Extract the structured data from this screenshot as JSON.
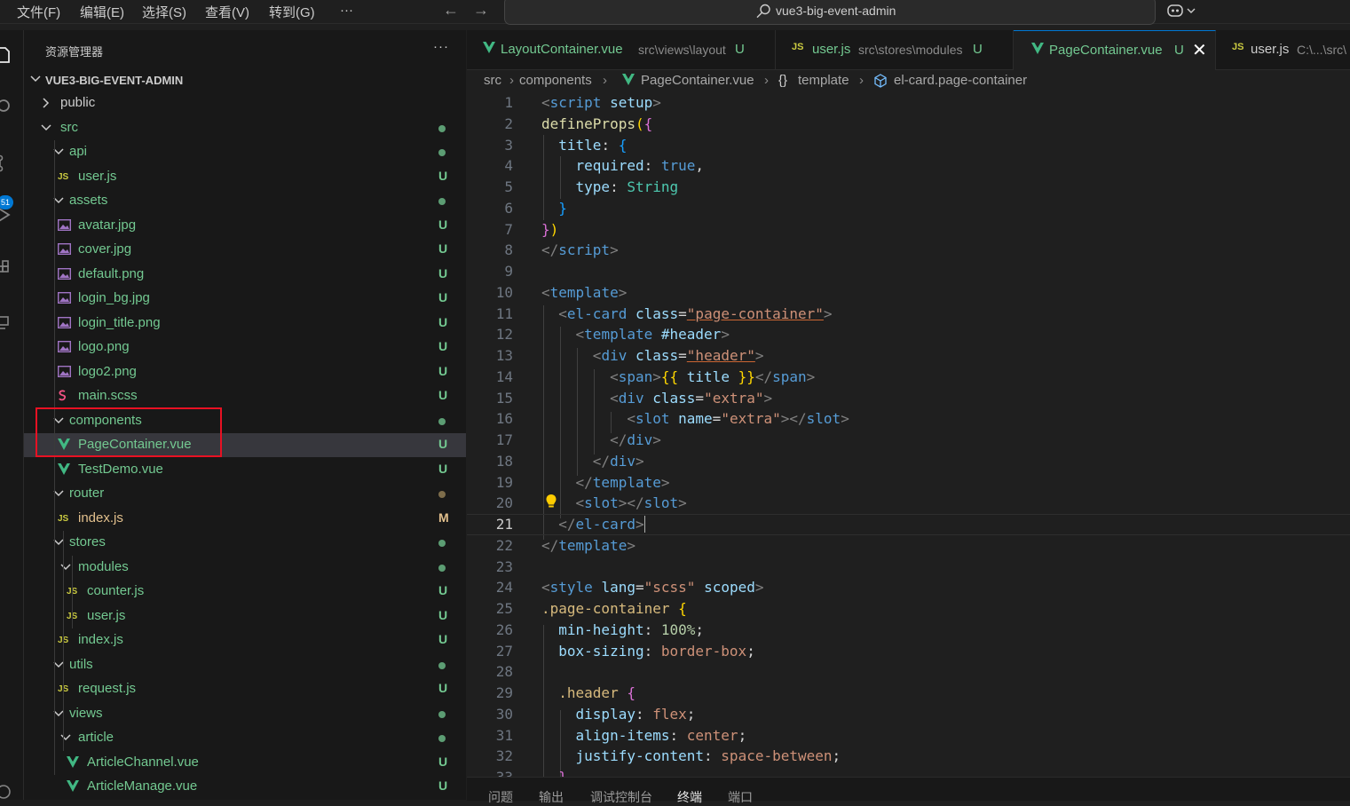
{
  "menu": [
    "文件(F)",
    "编辑(E)",
    "选择(S)",
    "查看(V)",
    "转到(G)",
    "···"
  ],
  "search": {
    "text": "vue3-big-event-admin"
  },
  "activity": {
    "scm_badge": "51"
  },
  "explorer": {
    "title": "资源管理器",
    "more": "···",
    "root": "VUE3-BIG-EVENT-ADMIN",
    "items": [
      {
        "label": "public",
        "kind": "folder-closed",
        "depth": 0,
        "status": "",
        "dot": false
      },
      {
        "label": "src",
        "kind": "folder",
        "depth": 0,
        "status": "",
        "dot": true,
        "dot_color": "#73c991"
      },
      {
        "label": "api",
        "kind": "folder",
        "depth": 1,
        "status": "",
        "dot": true,
        "dot_color": "#73c991"
      },
      {
        "label": "user.js",
        "kind": "js",
        "depth": 1,
        "status": "U"
      },
      {
        "label": "assets",
        "kind": "folder",
        "depth": 1,
        "status": "",
        "dot": true,
        "dot_color": "#73c991"
      },
      {
        "label": "avatar.jpg",
        "kind": "image",
        "depth": 1,
        "status": "U"
      },
      {
        "label": "cover.jpg",
        "kind": "image",
        "depth": 1,
        "status": "U"
      },
      {
        "label": "default.png",
        "kind": "image",
        "depth": 1,
        "status": "U"
      },
      {
        "label": "login_bg.jpg",
        "kind": "image",
        "depth": 1,
        "status": "U"
      },
      {
        "label": "login_title.png",
        "kind": "image",
        "depth": 1,
        "status": "U"
      },
      {
        "label": "logo.png",
        "kind": "image",
        "depth": 1,
        "status": "U"
      },
      {
        "label": "logo2.png",
        "kind": "image",
        "depth": 1,
        "status": "U"
      },
      {
        "label": "main.scss",
        "kind": "scss",
        "depth": 1,
        "status": "U"
      },
      {
        "label": "components",
        "kind": "folder",
        "depth": 1,
        "status": "",
        "dot": true,
        "dot_color": "#73c991"
      },
      {
        "label": "PageContainer.vue",
        "kind": "vue",
        "depth": 1,
        "status": "U",
        "selected": true
      },
      {
        "label": "TestDemo.vue",
        "kind": "vue",
        "depth": 1,
        "status": "U"
      },
      {
        "label": "router",
        "kind": "folder",
        "depth": 1,
        "status": "",
        "dot": true,
        "dot_color": "#a08a5c"
      },
      {
        "label": "index.js",
        "kind": "js",
        "depth": 1,
        "status": "M",
        "status_color": "#e2c08d"
      },
      {
        "label": "stores",
        "kind": "folder",
        "depth": 1,
        "status": "",
        "dot": true,
        "dot_color": "#73c991"
      },
      {
        "label": "modules",
        "kind": "folder",
        "depth": 2,
        "status": "",
        "dot": true,
        "dot_color": "#73c991"
      },
      {
        "label": "counter.js",
        "kind": "js",
        "depth": 2,
        "status": "U"
      },
      {
        "label": "user.js",
        "kind": "js",
        "depth": 2,
        "status": "U"
      },
      {
        "label": "index.js",
        "kind": "js",
        "depth": 1,
        "status": "U"
      },
      {
        "label": "utils",
        "kind": "folder",
        "depth": 1,
        "status": "",
        "dot": true,
        "dot_color": "#73c991"
      },
      {
        "label": "request.js",
        "kind": "js",
        "depth": 1,
        "status": "U"
      },
      {
        "label": "views",
        "kind": "folder",
        "depth": 1,
        "status": "",
        "dot": true,
        "dot_color": "#73c991"
      },
      {
        "label": "article",
        "kind": "folder",
        "depth": 2,
        "status": "",
        "dot": true,
        "dot_color": "#73c991"
      },
      {
        "label": "ArticleChannel.vue",
        "kind": "vue",
        "depth": 2,
        "status": "U"
      },
      {
        "label": "ArticleManage.vue",
        "kind": "vue",
        "depth": 2,
        "status": "U"
      }
    ]
  },
  "tabs": [
    {
      "name": "LayoutContainer.vue",
      "path": "src\\views\\layout",
      "status": "U",
      "kind": "vue",
      "active": false
    },
    {
      "name": "user.js",
      "path": "src\\stores\\modules",
      "status": "U",
      "kind": "js",
      "active": false
    },
    {
      "name": "PageContainer.vue",
      "path": "",
      "status": "U",
      "kind": "vue",
      "active": true,
      "close": "✕"
    },
    {
      "name": "user.js",
      "path": "C:\\...\\src\\",
      "status": "",
      "kind": "js",
      "active": false
    }
  ],
  "breadcrumb": {
    "parts": [
      "src",
      "components",
      "PageContainer.vue",
      "template",
      "el-card.page-container"
    ]
  },
  "editor": {
    "current_line": 21,
    "lines": [
      [
        [
          "tk-bracket",
          "<"
        ],
        [
          "tk-tag",
          "script"
        ],
        [
          "tk-plain",
          " "
        ],
        [
          "tk-attr",
          "setup"
        ],
        [
          "tk-bracket",
          ">"
        ]
      ],
      [
        [
          "tk-fn",
          "defineProps"
        ],
        [
          "tk-brace1",
          "("
        ],
        [
          "tk-brace2",
          "{"
        ]
      ],
      [
        [
          "tk-plain",
          "  "
        ],
        [
          "tk-attr",
          "title"
        ],
        [
          "tk-plain",
          ": "
        ],
        [
          "tk-brace3",
          "{"
        ]
      ],
      [
        [
          "tk-plain",
          "    "
        ],
        [
          "tk-attr",
          "required"
        ],
        [
          "tk-plain",
          ": "
        ],
        [
          "tk-kw",
          "true"
        ],
        [
          "tk-plain",
          ","
        ]
      ],
      [
        [
          "tk-plain",
          "    "
        ],
        [
          "tk-attr",
          "type"
        ],
        [
          "tk-plain",
          ": "
        ],
        [
          "tk-type",
          "String"
        ]
      ],
      [
        [
          "tk-plain",
          "  "
        ],
        [
          "tk-brace3",
          "}"
        ]
      ],
      [
        [
          "tk-brace2",
          "}"
        ],
        [
          "tk-brace1",
          ")"
        ]
      ],
      [
        [
          "tk-bracket",
          "</"
        ],
        [
          "tk-tag",
          "script"
        ],
        [
          "tk-bracket",
          ">"
        ]
      ],
      [],
      [
        [
          "tk-bracket",
          "<"
        ],
        [
          "tk-tag",
          "template"
        ],
        [
          "tk-bracket",
          ">"
        ]
      ],
      [
        [
          "tk-plain",
          "  "
        ],
        [
          "tk-bracket",
          "<"
        ],
        [
          "tk-tag",
          "el-card"
        ],
        [
          "tk-plain",
          " "
        ],
        [
          "tk-attr",
          "class"
        ],
        [
          "tk-plain",
          "="
        ],
        [
          "tk-str tk-squig",
          "\"page-container\""
        ],
        [
          "tk-bracket",
          ">"
        ]
      ],
      [
        [
          "tk-plain",
          "    "
        ],
        [
          "tk-bracket",
          "<"
        ],
        [
          "tk-tag",
          "template"
        ],
        [
          "tk-plain",
          " "
        ],
        [
          "tk-attr",
          "#header"
        ],
        [
          "tk-bracket",
          ">"
        ]
      ],
      [
        [
          "tk-plain",
          "      "
        ],
        [
          "tk-bracket",
          "<"
        ],
        [
          "tk-tag",
          "div"
        ],
        [
          "tk-plain",
          " "
        ],
        [
          "tk-attr",
          "class"
        ],
        [
          "tk-plain",
          "="
        ],
        [
          "tk-str tk-squig",
          "\"header\""
        ],
        [
          "tk-bracket",
          ">"
        ]
      ],
      [
        [
          "tk-plain",
          "        "
        ],
        [
          "tk-bracket",
          "<"
        ],
        [
          "tk-tag",
          "span"
        ],
        [
          "tk-bracket",
          ">"
        ],
        [
          "tk-brace1",
          "{{ "
        ],
        [
          "tk-attr",
          "title"
        ],
        [
          "tk-brace1",
          " }}"
        ],
        [
          "tk-bracket",
          "</"
        ],
        [
          "tk-tag",
          "span"
        ],
        [
          "tk-bracket",
          ">"
        ]
      ],
      [
        [
          "tk-plain",
          "        "
        ],
        [
          "tk-bracket",
          "<"
        ],
        [
          "tk-tag",
          "div"
        ],
        [
          "tk-plain",
          " "
        ],
        [
          "tk-attr",
          "class"
        ],
        [
          "tk-plain",
          "="
        ],
        [
          "tk-str",
          "\"extra\""
        ],
        [
          "tk-bracket",
          ">"
        ]
      ],
      [
        [
          "tk-plain",
          "          "
        ],
        [
          "tk-bracket",
          "<"
        ],
        [
          "tk-tag",
          "slot"
        ],
        [
          "tk-plain",
          " "
        ],
        [
          "tk-attr",
          "name"
        ],
        [
          "tk-plain",
          "="
        ],
        [
          "tk-str",
          "\"extra\""
        ],
        [
          "tk-bracket",
          "></"
        ],
        [
          "tk-tag",
          "slot"
        ],
        [
          "tk-bracket",
          ">"
        ]
      ],
      [
        [
          "tk-plain",
          "        "
        ],
        [
          "tk-bracket",
          "</"
        ],
        [
          "tk-tag",
          "div"
        ],
        [
          "tk-bracket",
          ">"
        ]
      ],
      [
        [
          "tk-plain",
          "      "
        ],
        [
          "tk-bracket",
          "</"
        ],
        [
          "tk-tag",
          "div"
        ],
        [
          "tk-bracket",
          ">"
        ]
      ],
      [
        [
          "tk-plain",
          "    "
        ],
        [
          "tk-bracket",
          "</"
        ],
        [
          "tk-tag",
          "template"
        ],
        [
          "tk-bracket",
          ">"
        ]
      ],
      [
        [
          "tk-plain",
          "    "
        ],
        [
          "tk-bracket",
          "<"
        ],
        [
          "tk-tag",
          "slot"
        ],
        [
          "tk-bracket",
          "></"
        ],
        [
          "tk-tag",
          "slot"
        ],
        [
          "tk-bracket",
          ">"
        ]
      ],
      [
        [
          "tk-plain",
          "  "
        ],
        [
          "tk-bracket",
          "</"
        ],
        [
          "tk-tag",
          "el-card"
        ],
        [
          "tk-bracket",
          ">"
        ]
      ],
      [
        [
          "tk-bracket",
          "</"
        ],
        [
          "tk-tag",
          "template"
        ],
        [
          "tk-bracket",
          ">"
        ]
      ],
      [],
      [
        [
          "tk-bracket",
          "<"
        ],
        [
          "tk-tag",
          "style"
        ],
        [
          "tk-plain",
          " "
        ],
        [
          "tk-attr",
          "lang"
        ],
        [
          "tk-plain",
          "="
        ],
        [
          "tk-str",
          "\"scss\""
        ],
        [
          "tk-plain",
          " "
        ],
        [
          "tk-attr",
          "scoped"
        ],
        [
          "tk-bracket",
          ">"
        ]
      ],
      [
        [
          "tk-class",
          ".page-container"
        ],
        [
          "tk-plain",
          " "
        ],
        [
          "tk-brace1",
          "{"
        ]
      ],
      [
        [
          "tk-plain",
          "  "
        ],
        [
          "tk-prop",
          "min-height"
        ],
        [
          "tk-plain",
          ": "
        ],
        [
          "tk-num",
          "100%"
        ],
        [
          "tk-plain",
          ";"
        ]
      ],
      [
        [
          "tk-plain",
          "  "
        ],
        [
          "tk-prop",
          "box-sizing"
        ],
        [
          "tk-plain",
          ": "
        ],
        [
          "tk-val",
          "border-box"
        ],
        [
          "tk-plain",
          ";"
        ]
      ],
      [],
      [
        [
          "tk-plain",
          "  "
        ],
        [
          "tk-class",
          ".header"
        ],
        [
          "tk-plain",
          " "
        ],
        [
          "tk-brace2",
          "{"
        ]
      ],
      [
        [
          "tk-plain",
          "    "
        ],
        [
          "tk-prop",
          "display"
        ],
        [
          "tk-plain",
          ": "
        ],
        [
          "tk-val",
          "flex"
        ],
        [
          "tk-plain",
          ";"
        ]
      ],
      [
        [
          "tk-plain",
          "    "
        ],
        [
          "tk-prop",
          "align-items"
        ],
        [
          "tk-plain",
          ": "
        ],
        [
          "tk-val",
          "center"
        ],
        [
          "tk-plain",
          ";"
        ]
      ],
      [
        [
          "tk-plain",
          "    "
        ],
        [
          "tk-prop",
          "justify-content"
        ],
        [
          "tk-plain",
          ": "
        ],
        [
          "tk-val",
          "space-between"
        ],
        [
          "tk-plain",
          ";"
        ]
      ],
      [
        [
          "tk-plain",
          "  "
        ],
        [
          "tk-brace2",
          "}"
        ]
      ]
    ]
  },
  "panel": {
    "tabs": [
      "问题",
      "输出",
      "调试控制台",
      "终端",
      "端口"
    ],
    "active": "终端"
  },
  "colors": {
    "accent": "#0078d4",
    "untracked": "#73c991",
    "modified": "#e2c08d",
    "vue": "#41b883",
    "js": "#cbcb41",
    "image": "#a074c4",
    "scss": "#f55385",
    "highlight": "#e81123"
  }
}
